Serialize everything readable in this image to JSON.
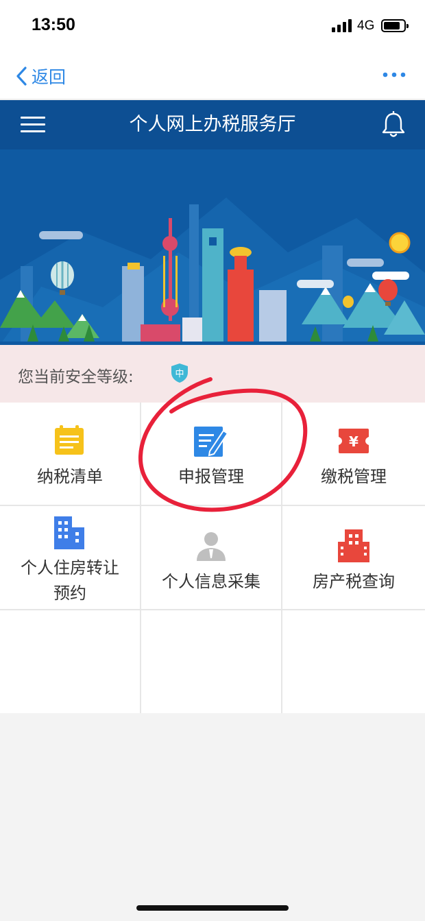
{
  "status_bar": {
    "time": "13:50",
    "network": "4G"
  },
  "nav": {
    "back_label": "返回",
    "back_icon": "chevron-left-icon",
    "more_icon": "more-dots-icon",
    "accent_color": "#2e88e5"
  },
  "header": {
    "title": "个人网上办税服务厅",
    "menu_icon": "hamburger-menu-icon",
    "bell_icon": "bell-icon",
    "background_color": "#0d4f93"
  },
  "security": {
    "label": "您当前安全等级:",
    "level": "中",
    "level_color": "#3fb8d6"
  },
  "grid_items": [
    {
      "label": "纳税清单",
      "icon": "document-list-icon",
      "color": "#f6c21a"
    },
    {
      "label": "申报管理",
      "icon": "edit-form-icon",
      "color": "#2e88e5"
    },
    {
      "label": "缴税管理",
      "icon": "yuan-ticket-icon",
      "color": "#e8473c"
    },
    {
      "label": "个人住房转让预约",
      "label_line1": "个人住房转让",
      "label_line2": "预约",
      "icon": "building-icon",
      "color": "#3f7ee8"
    },
    {
      "label": "个人信息采集",
      "icon": "person-icon",
      "color": "#bfbfbf"
    },
    {
      "label": "房产税查询",
      "icon": "buildings-icon",
      "color": "#e8473c"
    }
  ]
}
